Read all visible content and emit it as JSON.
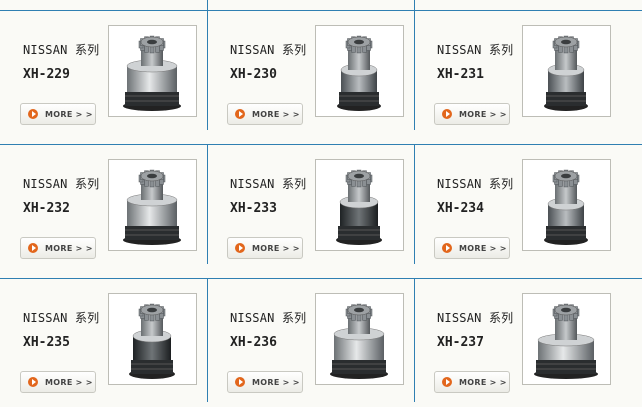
{
  "products": [
    {
      "series": "NISSAN 系列",
      "model": "XH-229",
      "more_label": "MORE > >",
      "image_label": "starter-drive-gear-photo"
    },
    {
      "series": "NISSAN 系列",
      "model": "XH-230",
      "more_label": "MORE > >",
      "image_label": "starter-drive-gear-photo"
    },
    {
      "series": "NISSAN 系列",
      "model": "XH-231",
      "more_label": "MORE > >",
      "image_label": "starter-drive-gear-photo"
    },
    {
      "series": "NISSAN 系列",
      "model": "XH-232",
      "more_label": "MORE > >",
      "image_label": "starter-drive-gear-photo"
    },
    {
      "series": "NISSAN 系列",
      "model": "XH-233",
      "more_label": "MORE > >",
      "image_label": "starter-drive-gear-photo"
    },
    {
      "series": "NISSAN 系列",
      "model": "XH-234",
      "more_label": "MORE > >",
      "image_label": "starter-drive-gear-photo"
    },
    {
      "series": "NISSAN 系列",
      "model": "XH-235",
      "more_label": "MORE > >",
      "image_label": "starter-drive-gear-photo"
    },
    {
      "series": "NISSAN 系列",
      "model": "XH-236",
      "more_label": "MORE > >",
      "image_label": "starter-drive-gear-photo"
    },
    {
      "series": "NISSAN 系列",
      "model": "XH-237",
      "more_label": "MORE > >",
      "image_label": "starter-drive-gear-photo"
    }
  ],
  "colors": {
    "divider": "#2f7fb2",
    "button_dot": "#e2661c",
    "text": "#222222"
  }
}
